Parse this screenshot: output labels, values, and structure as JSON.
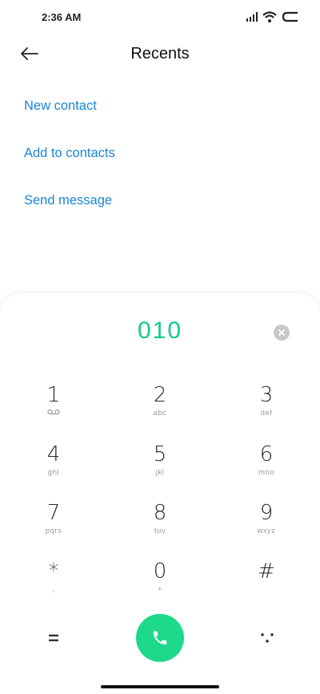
{
  "status": {
    "time": "2:36 AM"
  },
  "header": {
    "title": "Recents"
  },
  "actions": {
    "new_contact": "New contact",
    "add_to_contacts": "Add to contacts",
    "send_message": "Send message"
  },
  "dialpad": {
    "number": "010",
    "keys": [
      {
        "digit": "1",
        "letters": ""
      },
      {
        "digit": "2",
        "letters": "abc"
      },
      {
        "digit": "3",
        "letters": "def"
      },
      {
        "digit": "4",
        "letters": "ghi"
      },
      {
        "digit": "5",
        "letters": "jkl"
      },
      {
        "digit": "6",
        "letters": "mno"
      },
      {
        "digit": "7",
        "letters": "pqrs"
      },
      {
        "digit": "8",
        "letters": "tuv"
      },
      {
        "digit": "9",
        "letters": "wxyz"
      },
      {
        "digit": "*",
        "letters": ","
      },
      {
        "digit": "0",
        "letters": "+"
      },
      {
        "digit": "#",
        "letters": ""
      }
    ]
  },
  "colors": {
    "accent_blue": "#1a86d6",
    "dial_green": "#14c98a",
    "call_green": "#1ed98a"
  },
  "icons": [
    "signal-icon",
    "wifi-icon",
    "battery-icon",
    "back-arrow-icon",
    "clear-icon",
    "voicemail-icon",
    "equals-icon",
    "phone-icon",
    "more-dots-icon"
  ]
}
